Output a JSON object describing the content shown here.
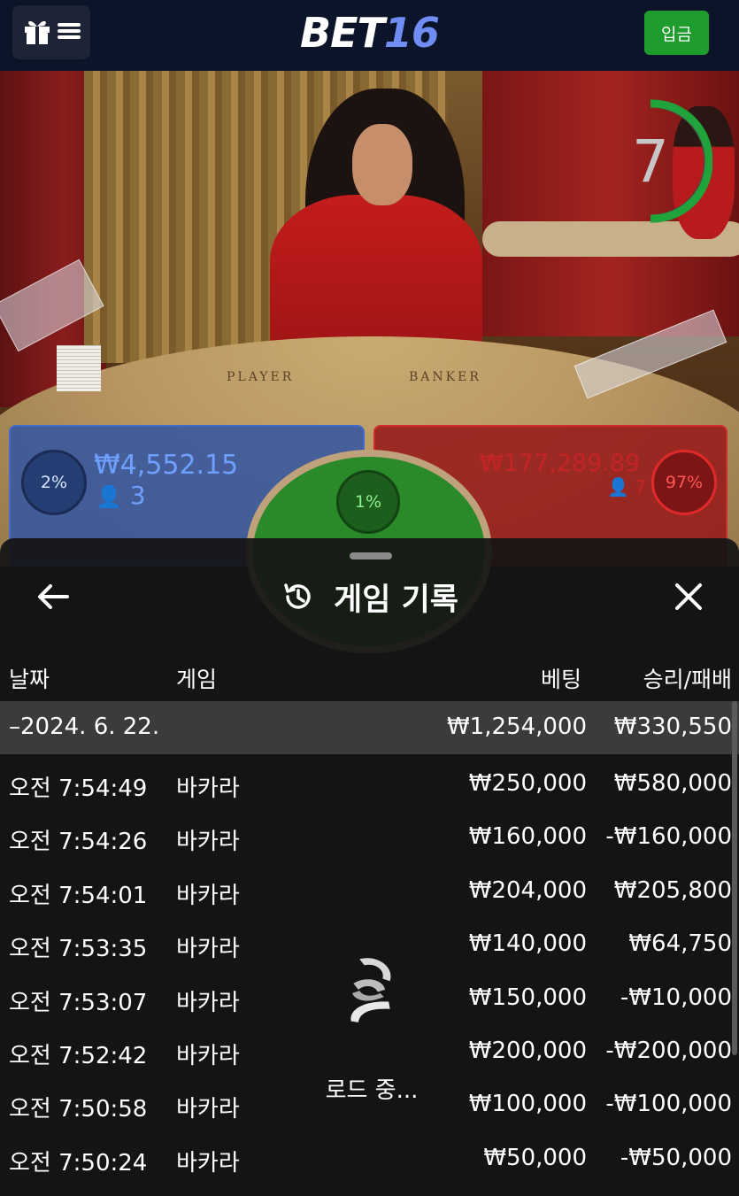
{
  "header": {
    "logo_part1": "BET",
    "logo_part2": "16",
    "deposit_label": "입금",
    "accent_color": "#6f8df2",
    "deposit_color": "#1e9c2e"
  },
  "video": {
    "countdown": "7",
    "table_label_player": "PLAYER",
    "table_label_banker": "BANKER",
    "player_bet": {
      "percent": "2%",
      "amount": "₩4,552.15",
      "players": "3"
    },
    "banker_bet": {
      "percent": "97%",
      "amount": "₩177,289.89",
      "players": "7"
    },
    "tie_bet": {
      "percent": "1%"
    }
  },
  "history": {
    "title": "게임 기록",
    "columns": {
      "date": "날짜",
      "game": "게임",
      "bet": "베팅",
      "result": "승리/패배"
    },
    "date_group": {
      "date": "–2024. 6. 22.",
      "bet": "₩1,254,000",
      "result": "₩330,550"
    },
    "rows": [
      {
        "time": "오전 7:54:49",
        "game": "바카라",
        "bet": "₩250,000",
        "result": "₩580,000"
      },
      {
        "time": "오전 7:54:26",
        "game": "바카라",
        "bet": "₩160,000",
        "result": "-₩160,000"
      },
      {
        "time": "오전 7:54:01",
        "game": "바카라",
        "bet": "₩204,000",
        "result": "₩205,800"
      },
      {
        "time": "오전 7:53:35",
        "game": "바카라",
        "bet": "₩140,000",
        "result": "₩64,750"
      },
      {
        "time": "오전 7:53:07",
        "game": "바카라",
        "bet": "₩150,000",
        "result": "-₩10,000"
      },
      {
        "time": "오전 7:52:42",
        "game": "바카라",
        "bet": "₩200,000",
        "result": "-₩200,000"
      },
      {
        "time": "오전 7:50:58",
        "game": "바카라",
        "bet": "₩100,000",
        "result": "-₩100,000"
      },
      {
        "time": "오전 7:50:24",
        "game": "바카라",
        "bet": "₩50,000",
        "result": "-₩50,000"
      }
    ],
    "loading_text": "로드 중..."
  },
  "icons": {
    "menu": "gift-menu-icon",
    "back": "arrow-left-icon",
    "history": "history-icon",
    "close": "close-icon",
    "loader": "loading-spinner-icon"
  }
}
